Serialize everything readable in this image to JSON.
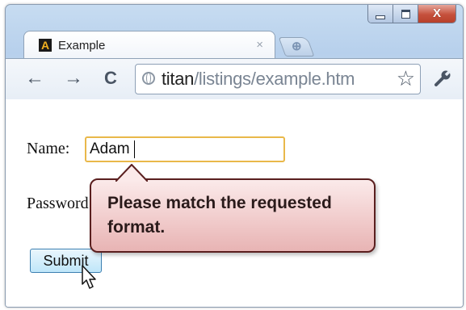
{
  "window": {
    "controls": {
      "minimize_icon": "minimize-icon",
      "maximize_icon": "maximize-icon",
      "close_icon": "close-icon",
      "close_glyph": "X"
    }
  },
  "tab": {
    "title": "Example",
    "close_glyph": "×",
    "favicon_letter": "A"
  },
  "toolbar": {
    "back_glyph": "←",
    "forward_glyph": "→",
    "reload_glyph": "C",
    "url_host": "titan",
    "url_path": "/listings/example.htm",
    "star_glyph": "☆",
    "wrench_glyph": "🔧"
  },
  "form": {
    "name_label": "Name:",
    "name_value": "Adam",
    "password_label": "Password:",
    "submit_label": "Submit"
  },
  "validation_tooltip": {
    "message": "Please match the requested format."
  },
  "colors": {
    "input_focus_border": "#e9b84a",
    "tooltip_border": "#5a1f1f",
    "tooltip_fill": "#f1cccc",
    "close_button": "#c5513c"
  }
}
